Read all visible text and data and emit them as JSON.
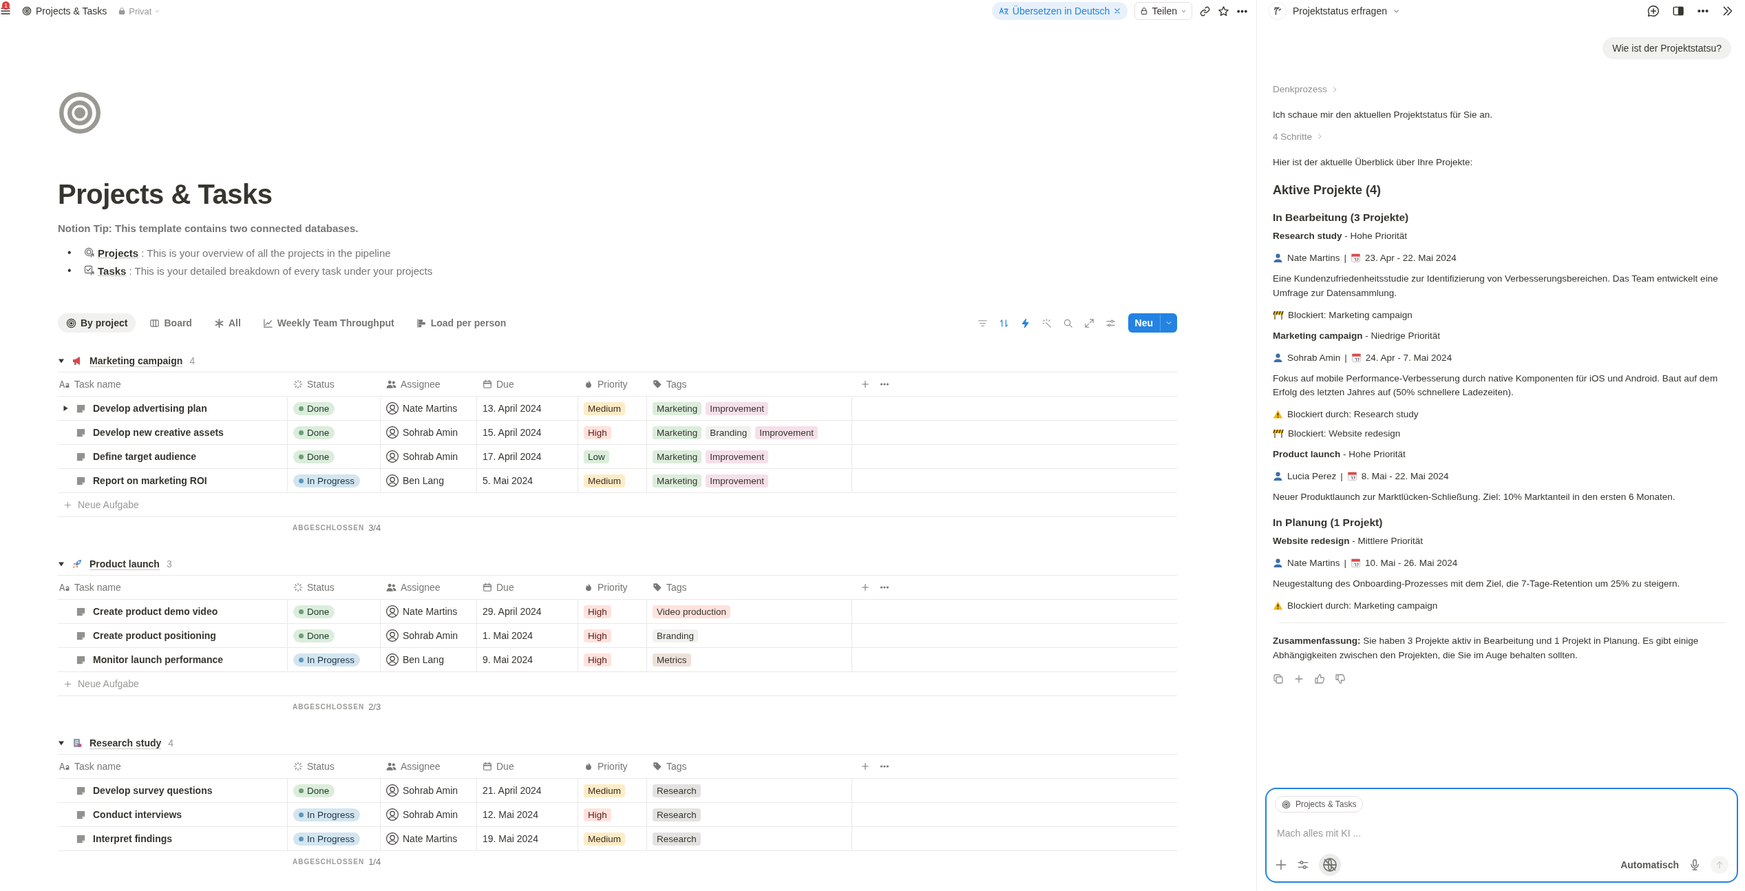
{
  "topbar": {
    "notifications": "1",
    "breadcrumb": "Projects & Tasks",
    "privacy": "Privat",
    "translate": "Übersetzen in Deutsch",
    "share": "Teilen"
  },
  "page": {
    "title": "Projects & Tasks",
    "tip": "Notion Tip: This template contains two connected databases.",
    "bullets": [
      {
        "kind": "projects",
        "marker": "•",
        "link": "Projects",
        "text": ": This is your overview of all the projects in the pipeline"
      },
      {
        "kind": "tasks",
        "marker": "•",
        "link": "Tasks",
        "text": ": This is your detailed breakdown of every task under your projects"
      }
    ]
  },
  "views": [
    {
      "kind": "target",
      "label": "By project",
      "selected": true
    },
    {
      "kind": "board",
      "label": "Board",
      "selected": false
    },
    {
      "kind": "asterisk",
      "label": "All",
      "selected": false
    },
    {
      "kind": "chart",
      "label": "Weekly Team Throughput",
      "selected": false
    },
    {
      "kind": "gantt",
      "label": "Load per person",
      "selected": false
    }
  ],
  "tools": [
    {
      "kind": "filter",
      "active": false
    },
    {
      "kind": "sort",
      "active": true
    },
    {
      "kind": "bolt",
      "active": true
    },
    {
      "kind": "sparkle",
      "active": false
    },
    {
      "kind": "search",
      "active": false
    },
    {
      "kind": "expand",
      "active": false
    },
    {
      "kind": "sliders",
      "active": false
    }
  ],
  "new_button": "Neu",
  "groups": [
    {
      "kind": "megaphone",
      "name": "Marketing campaign",
      "count": "4",
      "expanded": true,
      "columns": [
        "Task name",
        "Status",
        "Assignee",
        "Due",
        "Priority",
        "Tags"
      ],
      "rows": [
        {
          "name": "Develop advertising plan",
          "has_subtasks": true,
          "status": {
            "label": "Done",
            "kind": "done"
          },
          "assignee": "Nate Martins",
          "due": "13. April 2024",
          "priority": {
            "label": "Medium",
            "kind": "medium"
          },
          "tags": [
            {
              "label": "Marketing",
              "color": "#dbeddb"
            },
            {
              "label": "Improvement",
              "color": "#f5e0e9"
            }
          ]
        },
        {
          "name": "Develop new creative assets",
          "has_subtasks": false,
          "status": {
            "label": "Done",
            "kind": "done"
          },
          "assignee": "Sohrab Amin",
          "due": "15. April 2024",
          "priority": {
            "label": "High",
            "kind": "high"
          },
          "tags": [
            {
              "label": "Marketing",
              "color": "#dbeddb"
            },
            {
              "label": "Branding",
              "color": "#f1f1ef"
            },
            {
              "label": "Improvement",
              "color": "#f5e0e9"
            }
          ]
        },
        {
          "name": "Define target audience",
          "has_subtasks": false,
          "status": {
            "label": "Done",
            "kind": "done"
          },
          "assignee": "Sohrab Amin",
          "due": "17. April 2024",
          "priority": {
            "label": "Low",
            "kind": "low"
          },
          "tags": [
            {
              "label": "Marketing",
              "color": "#dbeddb"
            },
            {
              "label": "Improvement",
              "color": "#f5e0e9"
            }
          ]
        },
        {
          "name": "Report on marketing ROI",
          "has_subtasks": false,
          "status": {
            "label": "In Progress",
            "kind": "in_progress"
          },
          "assignee": "Ben Lang",
          "due": "5. Mai 2024",
          "priority": {
            "label": "Medium",
            "kind": "medium"
          },
          "tags": [
            {
              "label": "Marketing",
              "color": "#dbeddb"
            },
            {
              "label": "Improvement",
              "color": "#f5e0e9"
            }
          ]
        }
      ],
      "add_label": "Neue Aufgabe",
      "summary_label": "ABGESCHLOSSEN",
      "summary_value": "3/4"
    },
    {
      "kind": "rocket",
      "name": "Product launch",
      "count": "3",
      "expanded": true,
      "columns": [
        "Task name",
        "Status",
        "Assignee",
        "Due",
        "Priority",
        "Tags"
      ],
      "rows": [
        {
          "name": "Create product demo video",
          "has_subtasks": false,
          "status": {
            "label": "Done",
            "kind": "done"
          },
          "assignee": "Nate Martins",
          "due": "29. April 2024",
          "priority": {
            "label": "High",
            "kind": "high"
          },
          "tags": [
            {
              "label": "Video production",
              "color": "#ffe2dd"
            }
          ]
        },
        {
          "name": "Create product positioning",
          "has_subtasks": false,
          "status": {
            "label": "Done",
            "kind": "done"
          },
          "assignee": "Sohrab Amin",
          "due": "1. Mai 2024",
          "priority": {
            "label": "High",
            "kind": "high"
          },
          "tags": [
            {
              "label": "Branding",
              "color": "#f1f1ef"
            }
          ]
        },
        {
          "name": "Monitor launch performance",
          "has_subtasks": false,
          "status": {
            "label": "In Progress",
            "kind": "in_progress"
          },
          "assignee": "Ben Lang",
          "due": "9. Mai 2024",
          "priority": {
            "label": "High",
            "kind": "high"
          },
          "tags": [
            {
              "label": "Metrics",
              "color": "#eee0da"
            }
          ]
        }
      ],
      "add_label": "Neue Aufgabe",
      "summary_label": "ABGESCHLOSSEN",
      "summary_value": "2/3"
    },
    {
      "kind": "document",
      "name": "Research study",
      "count": "4",
      "expanded": true,
      "columns": [
        "Task name",
        "Status",
        "Assignee",
        "Due",
        "Priority",
        "Tags"
      ],
      "rows": [
        {
          "name": "Develop survey questions",
          "has_subtasks": false,
          "status": {
            "label": "Done",
            "kind": "done"
          },
          "assignee": "Sohrab Amin",
          "due": "21. April 2024",
          "priority": {
            "label": "Medium",
            "kind": "medium"
          },
          "tags": [
            {
              "label": "Research",
              "color": "#e3e2e0"
            }
          ]
        },
        {
          "name": "Conduct interviews",
          "has_subtasks": false,
          "status": {
            "label": "In Progress",
            "kind": "in_progress"
          },
          "assignee": "Sohrab Amin",
          "due": "12. Mai 2024",
          "priority": {
            "label": "High",
            "kind": "high"
          },
          "tags": [
            {
              "label": "Research",
              "color": "#e3e2e0"
            }
          ]
        },
        {
          "name": "Interpret findings",
          "has_subtasks": false,
          "status": {
            "label": "In Progress",
            "kind": "in_progress"
          },
          "assignee": "Nate Martins",
          "due": "19. Mai 2024",
          "priority": {
            "label": "Medium",
            "kind": "medium"
          },
          "tags": [
            {
              "label": "Research",
              "color": "#e3e2e0"
            }
          ]
        }
      ],
      "summary_label": "ABGESCHLOSSEN",
      "summary_value": "1/4"
    }
  ],
  "chat": {
    "title": "Projektstatus erfragen",
    "user_message": "Wie ist der Projektstatsu?",
    "blocks": [
      {
        "kind": "disclosure",
        "text": "Denkprozess"
      },
      {
        "kind": "paragraph",
        "text": "Ich schaue mir den aktuellen Projektstatus für Sie an."
      },
      {
        "kind": "disclosure",
        "text": "4 Schritte"
      },
      {
        "kind": "paragraph",
        "text": "Hier ist der aktuelle Überblick über Ihre Projekte:"
      },
      {
        "kind": "h2",
        "text": "Aktive Projekte (4)"
      },
      {
        "kind": "h3",
        "text": "In Bearbeitung (3 Projekte)"
      },
      {
        "kind": "paragraph",
        "text": "**Research study** - Hohe Priorität"
      },
      {
        "kind": "meta",
        "person": "Nate Martins",
        "separator": "|",
        "dates": "23. Apr - 22. Mai 2024"
      },
      {
        "kind": "paragraph",
        "text": "Eine Kundenzufriedenheitsstudie zur Identifizierung von Verbesserungsbereichen. Das Team entwickelt eine Umfrage zur Datensammlung."
      },
      {
        "kind": "barrier",
        "text": "Blockiert: Marketing campaign"
      },
      {
        "kind": "paragraph",
        "text": "**Marketing campaign** - Niedrige Priorität"
      },
      {
        "kind": "meta",
        "person": "Sohrab Amin",
        "separator": "|",
        "dates": "24. Apr - 7. Mai 2024"
      },
      {
        "kind": "paragraph",
        "text": "Fokus auf mobile Performance-Verbesserung durch native Komponenten für iOS und Android. Baut auf dem Erfolg des letzten Jahres auf (50% schnellere Ladezeiten)."
      },
      {
        "kind": "warning",
        "text": "Blockiert durch: Research study"
      },
      {
        "kind": "barrier",
        "text": "Blockiert: Website redesign"
      },
      {
        "kind": "paragraph",
        "text": "**Product launch** - Hohe Priorität"
      },
      {
        "kind": "meta",
        "person": "Lucia Perez",
        "separator": "|",
        "dates": "8. Mai - 22. Mai 2024"
      },
      {
        "kind": "paragraph",
        "text": "Neuer Produktlaunch zur Marktlücken-Schließung. Ziel: 10% Marktanteil in den ersten 6 Monaten."
      },
      {
        "kind": "h3",
        "text": "In Planung (1 Projekt)"
      },
      {
        "kind": "paragraph",
        "text": "**Website redesign** - Mittlere Priorität"
      },
      {
        "kind": "meta",
        "person": "Nate Martins",
        "separator": "|",
        "dates": "10. Mai - 26. Mai 2024"
      },
      {
        "kind": "paragraph",
        "text": "Neugestaltung des Onboarding-Prozesses mit dem Ziel, die 7-Tage-Retention um 25% zu steigern."
      },
      {
        "kind": "warning",
        "text": "Blockiert durch: Marketing campaign"
      },
      {
        "kind": "divider"
      },
      {
        "kind": "paragraph",
        "text": "**Zusammenfassung:** Sie haben 3 Projekte aktiv in Bearbeitung und 1 Projekt in Planung. Es gibt einige Abhängigkeiten zwischen den Projekten, die Sie im Auge behalten sollten."
      }
    ],
    "composer": {
      "context": "Projects & Tasks",
      "placeholder": "Mach alles mit KI ...",
      "mode": "Automatisch"
    }
  }
}
